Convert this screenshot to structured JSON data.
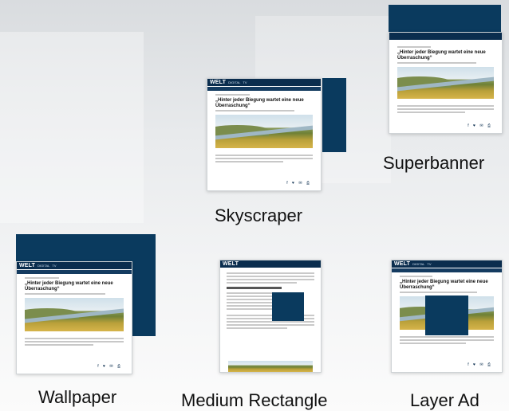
{
  "formats": [
    {
      "key": "superbanner",
      "label": "Superbanner"
    },
    {
      "key": "skyscraper",
      "label": "Skyscraper"
    },
    {
      "key": "wallpaper",
      "label": "Wallpaper"
    },
    {
      "key": "medium_rectangle",
      "label": "Medium Rectangle"
    },
    {
      "key": "layer_ad",
      "label": "Layer Ad"
    }
  ],
  "mockup": {
    "logo": "WELT",
    "nav_items": [
      "DIGITAL",
      "TV"
    ],
    "headline": "„Hinter jeder Biegung wartet eine neue Überraschung“",
    "share_icons": "f ♥ ✉ ⎙"
  },
  "colors": {
    "ad_block": "#0a3a5e",
    "nav": "#0a2d4e"
  }
}
